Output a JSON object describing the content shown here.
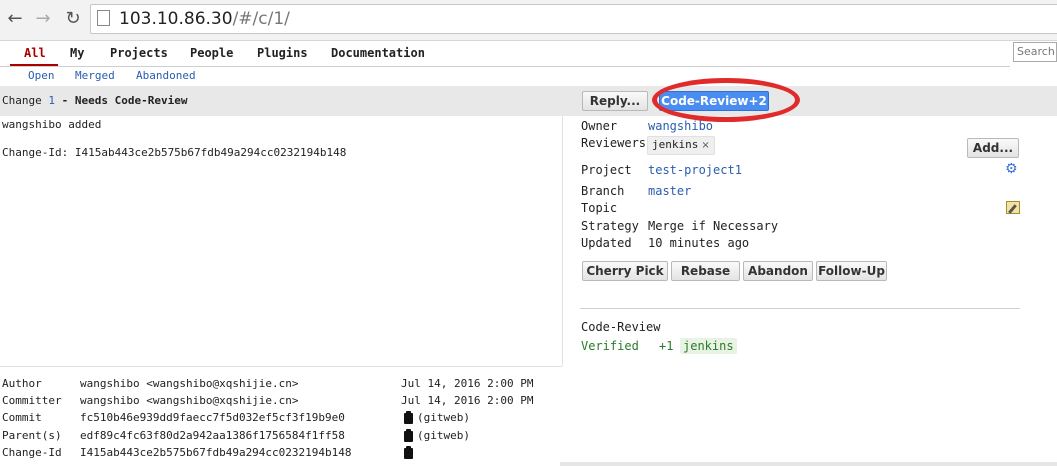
{
  "browser": {
    "url_host": "103.10.86.30",
    "url_path": "/#/c/1/",
    "back_icon": "arrow-left",
    "forward_icon": "arrow-right",
    "reload_icon": "reload"
  },
  "nav": {
    "menu": [
      "All",
      "My",
      "Projects",
      "People",
      "Plugins",
      "Documentation"
    ],
    "submenu": [
      "Open",
      "Merged",
      "Abandoned"
    ],
    "search_placeholder": "Search"
  },
  "change": {
    "title_prefix": "Change ",
    "number": "1",
    "title_suffix": " - Needs Code-Review",
    "reply_label": "Reply...",
    "code_review_label": "Code-Review+2",
    "message_line1": "wangshibo added",
    "message_line2": "Change-Id: I415ab443ce2b575b67fdb49a294cc0232194b148"
  },
  "info": {
    "owner_label": "Owner",
    "owner_value": "wangshibo",
    "reviewers_label": "Reviewers",
    "reviewer_name": "jenkins",
    "reviewer_remove": "×",
    "add_label": "Add...",
    "project_label": "Project",
    "project_value": "test-project1",
    "branch_label": "Branch",
    "branch_value": "master",
    "topic_label": "Topic",
    "strategy_label": "Strategy",
    "strategy_value": "Merge if Necessary",
    "updated_label": "Updated",
    "updated_value": "10 minutes ago"
  },
  "actions": [
    "Cherry Pick",
    "Rebase",
    "Abandon",
    "Follow-Up"
  ],
  "labels": {
    "code_review": "Code-Review",
    "verified": "Verified",
    "verified_score": "+1",
    "verified_by": "jenkins"
  },
  "commit": {
    "author_label": "Author",
    "author_value": "wangshibo <wangshibo@xqshijie.cn>",
    "author_date": "Jul 14, 2016 2:00 PM",
    "committer_label": "Committer",
    "committer_value": "wangshibo <wangshibo@xqshijie.cn>",
    "committer_date": "Jul 14, 2016 2:00 PM",
    "commit_label": "Commit",
    "commit_value": "fc510b46e939dd9faecc7f5d032ef5cf3f19b9e0",
    "parents_label": "Parent(s)",
    "parents_value": "edf89c4fc63f80d2a942aa1386f1756584f1ff58",
    "changeid_label": "Change-Id",
    "changeid_value": "I415ab443ce2b575b67fdb49a294cc0232194b148",
    "gitweb_label": "(gitweb)"
  }
}
